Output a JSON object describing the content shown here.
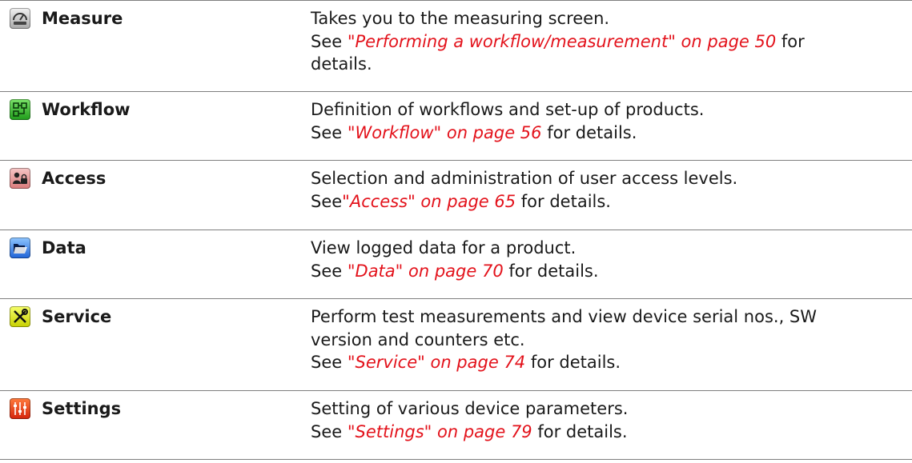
{
  "rows": [
    {
      "icon": "measure-gauge-icon",
      "name": "Measure",
      "lines": [
        "Takes you to the measuring screen."
      ],
      "see_prefix": "See ",
      "link": "\"Performing a workflow/measurement\" on page 50",
      "see_suffix": " for",
      "extra_line": "details."
    },
    {
      "icon": "workflow-icon",
      "name": "Workflow",
      "lines": [
        "Definition of workflows and set-up of products."
      ],
      "see_prefix": "See ",
      "link": "\"Workflow\" on page 56",
      "see_suffix": " for details."
    },
    {
      "icon": "access-user-lock-icon",
      "name": "Access",
      "lines": [
        "Selection and administration of user access levels."
      ],
      "see_prefix": "See",
      "link": "\"Access\" on page 65",
      "see_suffix": " for details."
    },
    {
      "icon": "data-folder-icon",
      "name": "Data",
      "lines": [
        "View logged data for a product."
      ],
      "see_prefix": "See ",
      "link": "\"Data\" on page 70",
      "see_suffix": " for details."
    },
    {
      "icon": "service-tools-icon",
      "name": "Service",
      "lines": [
        "Perform test measurements and view device serial nos., SW",
        "version and counters etc."
      ],
      "see_prefix": "See ",
      "link": "\"Service\" on page 74",
      "see_suffix": " for details."
    },
    {
      "icon": "settings-sliders-icon",
      "name": "Settings",
      "lines": [
        "Setting of various device parameters."
      ],
      "see_prefix": "See ",
      "link": "\"Settings\" on page 79",
      "see_suffix": " for details."
    }
  ],
  "colors": {
    "link": "#e3121b",
    "rule": "#7f7f7f"
  }
}
